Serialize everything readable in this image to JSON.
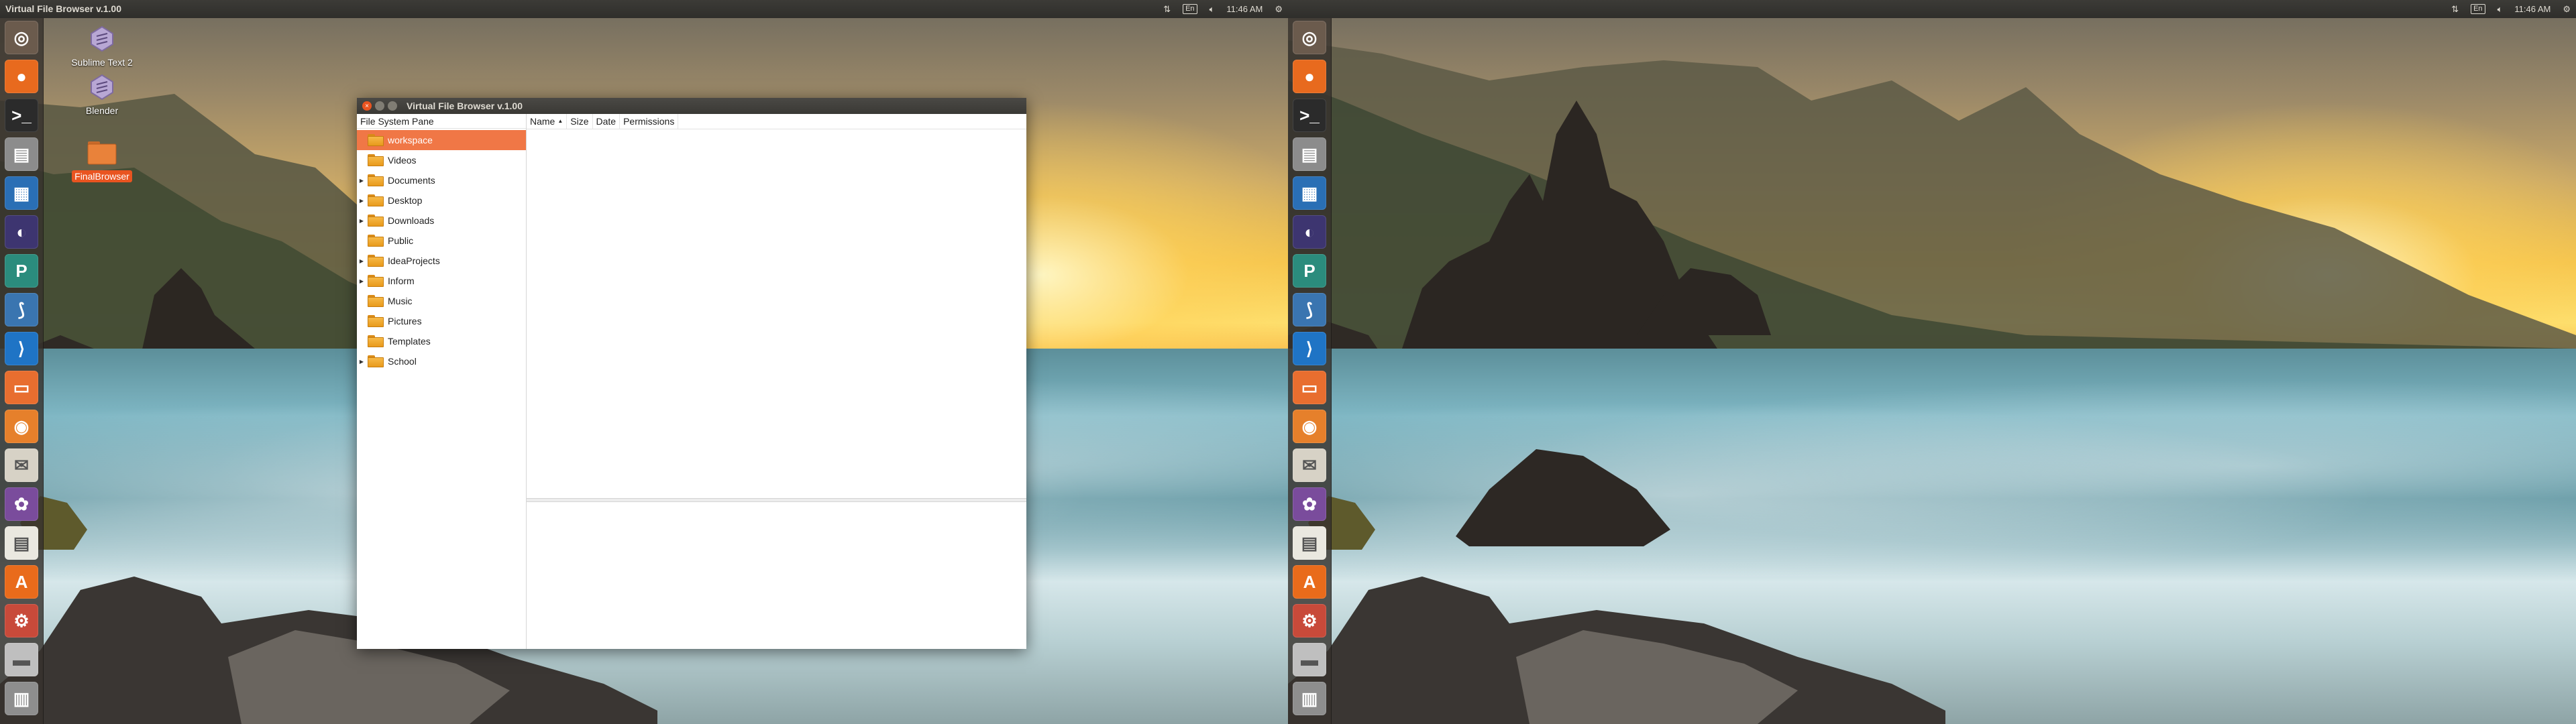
{
  "panel": {
    "title": "Virtual File Browser v.1.00",
    "indicators": {
      "keyboard_icon": "arrows-updown-icon",
      "language": "En",
      "volume_icon": "speaker-icon",
      "clock": "11:46 AM",
      "settings_icon": "gear-icon"
    }
  },
  "launcher": {
    "items": [
      {
        "name": "ubuntu-dash",
        "glyph": "◎",
        "color": "#6b5b4d"
      },
      {
        "name": "firefox",
        "glyph": "●",
        "color": "#e86a1e"
      },
      {
        "name": "terminal",
        "glyph": ">_",
        "color": "#2b2b2b"
      },
      {
        "name": "files",
        "glyph": "▤",
        "color": "#8c8c8c"
      },
      {
        "name": "libreoffice-writer",
        "glyph": "▦",
        "color": "#2a6fb5"
      },
      {
        "name": "eclipse",
        "glyph": "◐",
        "color": "#3d3570"
      },
      {
        "name": "pycharm",
        "glyph": "P",
        "color": "#2b8c7d"
      },
      {
        "name": "python",
        "glyph": "⟆",
        "color": "#3a75b0"
      },
      {
        "name": "vscode",
        "glyph": "⟩",
        "color": "#1f74c5"
      },
      {
        "name": "folder",
        "glyph": "▭",
        "color": "#e86e2f"
      },
      {
        "name": "blender",
        "glyph": "◉",
        "color": "#e6802b"
      },
      {
        "name": "mail",
        "glyph": "✉",
        "color": "#d7d2c6"
      },
      {
        "name": "lavender-app",
        "glyph": "✿",
        "color": "#7a4c9c"
      },
      {
        "name": "document",
        "glyph": "▤",
        "color": "#eae8e0"
      },
      {
        "name": "software-center",
        "glyph": "A",
        "color": "#e96b1b"
      },
      {
        "name": "settings",
        "glyph": "⚙",
        "color": "#c84a3a"
      },
      {
        "name": "drive",
        "glyph": "▬",
        "color": "#bfbfbf"
      },
      {
        "name": "trash",
        "glyph": "▥",
        "color": "#8e8e8e"
      }
    ]
  },
  "desktop": {
    "icons": [
      {
        "label": "Sublime Text 2"
      },
      {
        "label": "Blender"
      },
      {
        "label": "FinalBrowser"
      }
    ]
  },
  "window": {
    "title": "Virtual File Browser v.1.00",
    "left_header": "File System Pane",
    "tree": [
      {
        "label": "workspace",
        "expandable": false,
        "selected": true
      },
      {
        "label": "Videos",
        "expandable": false,
        "selected": false
      },
      {
        "label": "Documents",
        "expandable": true,
        "selected": false
      },
      {
        "label": "Desktop",
        "expandable": true,
        "selected": false
      },
      {
        "label": "Downloads",
        "expandable": true,
        "selected": false
      },
      {
        "label": "Public",
        "expandable": false,
        "selected": false
      },
      {
        "label": "IdeaProjects",
        "expandable": true,
        "selected": false
      },
      {
        "label": "Inform",
        "expandable": true,
        "selected": false
      },
      {
        "label": "Music",
        "expandable": false,
        "selected": false
      },
      {
        "label": "Pictures",
        "expandable": false,
        "selected": false
      },
      {
        "label": "Templates",
        "expandable": false,
        "selected": false
      },
      {
        "label": "School",
        "expandable": true,
        "selected": false
      }
    ],
    "columns": [
      {
        "label": "Name",
        "sorted": true
      },
      {
        "label": "Size",
        "sorted": false
      },
      {
        "label": "Date",
        "sorted": false
      },
      {
        "label": "Permissions",
        "sorted": false
      }
    ]
  },
  "colors": {
    "accent": "#e95420",
    "selection": "#f07746",
    "panel_bg": "#3c3b37"
  }
}
